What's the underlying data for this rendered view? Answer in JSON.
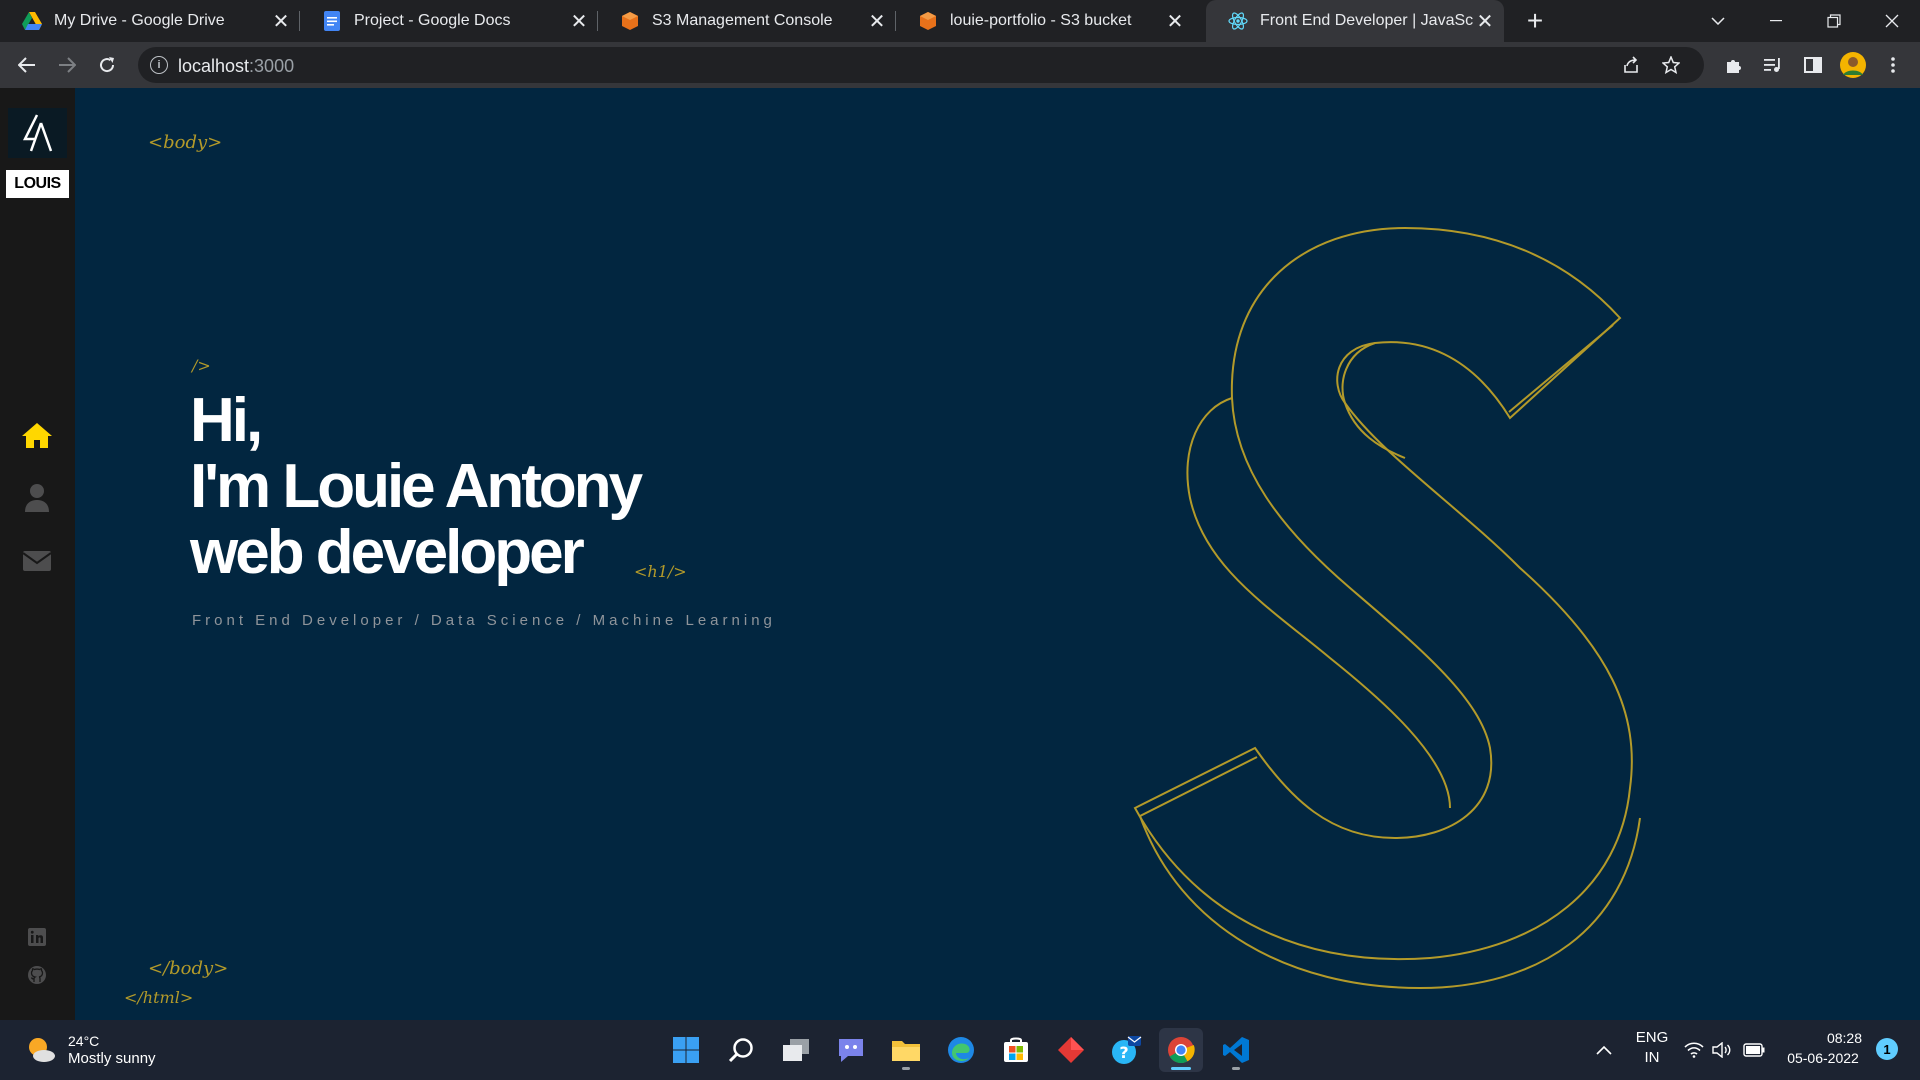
{
  "browser": {
    "tabs": [
      {
        "title": "My Drive - Google Drive",
        "icon": "google-drive-icon"
      },
      {
        "title": "Project - Google Docs",
        "icon": "google-docs-icon"
      },
      {
        "title": "S3 Management Console",
        "icon": "aws-icon"
      },
      {
        "title": "louie-portfolio - S3 bucket",
        "icon": "aws-icon"
      },
      {
        "title": "Front End Developer | JavaScript",
        "icon": "react-icon",
        "active": true
      }
    ],
    "url_host": "localhost",
    "url_path": ":3000"
  },
  "sidebar": {
    "logo_word": "LOUIS",
    "nav": [
      "home-icon",
      "user-icon",
      "mail-icon"
    ],
    "social": [
      "linkedin-icon",
      "github-icon"
    ],
    "accent": "#ffd700"
  },
  "hero": {
    "tag_body_open": "<body>",
    "tag_h1_open": "/>",
    "line1": "Hi,",
    "line2": "I'm Louie Antony",
    "line3": "web developer",
    "tag_h1_close": "<h1/>",
    "subtitle": "Front End Developer / Data Science / Machine Learning",
    "tag_body_close": "</body>",
    "tag_html_close": "</html>",
    "outline_color": "#b39a2a",
    "background": "#022640"
  },
  "taskbar": {
    "weather_temp": "24°C",
    "weather_desc": "Mostly sunny",
    "apps": [
      "windows-start-icon",
      "search-icon",
      "task-view-icon",
      "teams-chat-icon",
      "file-explorer-icon",
      "edge-icon",
      "store-icon",
      "git-icon",
      "mail-app-icon",
      "chrome-icon",
      "vscode-icon"
    ],
    "lang_line1": "ENG",
    "lang_line2": "IN",
    "time": "08:28",
    "date": "05-06-2022",
    "notifications": "1"
  }
}
